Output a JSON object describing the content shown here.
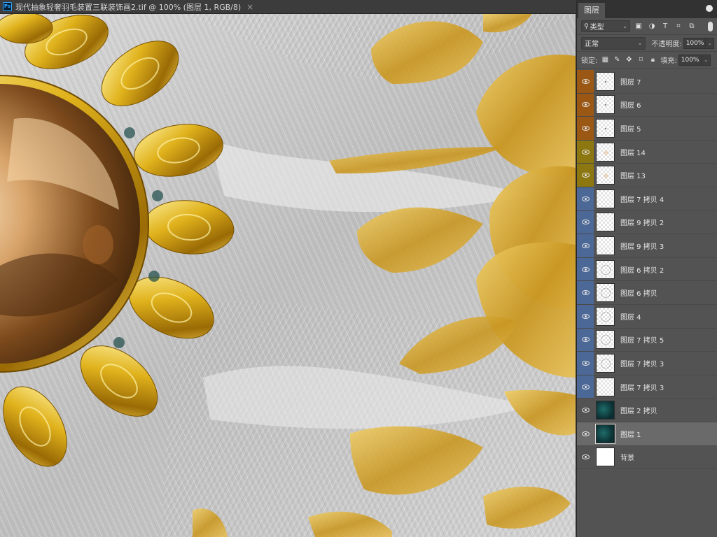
{
  "document": {
    "app_icon": "Ps",
    "title": "现代抽象轻奢羽毛装置三联装饰画2.tif @ 100% (图层 1, RGB/8)",
    "close_symbol": "×"
  },
  "panel": {
    "tab_label": "图层",
    "filter": {
      "kind_label": "类型",
      "icons": [
        "image-filter-icon",
        "adjustment-filter-icon",
        "text-filter-icon",
        "shape-filter-icon",
        "smart-object-filter-icon"
      ]
    },
    "blend_mode": "正常",
    "opacity_label": "不透明度:",
    "opacity_value": "100%",
    "lock_label": "锁定:",
    "fill_label": "填充:",
    "fill_value": "100%"
  },
  "layers": [
    {
      "name": "图层 7",
      "color": "#9a5814",
      "thumb": "dot",
      "visible": true
    },
    {
      "name": "图层 6",
      "color": "#9a5814",
      "thumb": "dot",
      "visible": true
    },
    {
      "name": "图层 5",
      "color": "#9a5814",
      "thumb": "dot",
      "visible": true
    },
    {
      "name": "图层 14",
      "color": "#8d7710",
      "thumb": "feather",
      "visible": true
    },
    {
      "name": "图层 13",
      "color": "#8d7710",
      "thumb": "feather",
      "visible": true
    },
    {
      "name": "图层 7 拷贝 4",
      "color": "#4c6897",
      "thumb": "empty",
      "visible": true
    },
    {
      "name": "图层 9 拷贝 2",
      "color": "#4c6897",
      "thumb": "empty",
      "visible": true
    },
    {
      "name": "图层 9 拷贝 3",
      "color": "#4c6897",
      "thumb": "empty",
      "visible": true
    },
    {
      "name": "图层 6 拷贝 2",
      "color": "#4c6897",
      "thumb": "ring",
      "visible": true
    },
    {
      "name": "图层 6 拷贝",
      "color": "#4c6897",
      "thumb": "ring",
      "visible": true
    },
    {
      "name": "图层 4",
      "color": "#4c6897",
      "thumb": "ring",
      "visible": true
    },
    {
      "name": "图层 7 拷贝 5",
      "color": "#4c6897",
      "thumb": "ring",
      "visible": true
    },
    {
      "name": "图层 7 拷贝 3",
      "color": "#4c6897",
      "thumb": "ring",
      "visible": true
    },
    {
      "name": "图层 7 拷贝 3",
      "color": "#4c6897",
      "thumb": "empty",
      "visible": true
    },
    {
      "name": "图层 2 拷贝",
      "color": "none",
      "thumb": "teal",
      "visible": true
    },
    {
      "name": "图层 1",
      "color": "none",
      "thumb": "teal",
      "visible": true,
      "selected": true
    },
    {
      "name": "背景",
      "color": "none",
      "thumb": "white",
      "visible": true
    }
  ]
}
